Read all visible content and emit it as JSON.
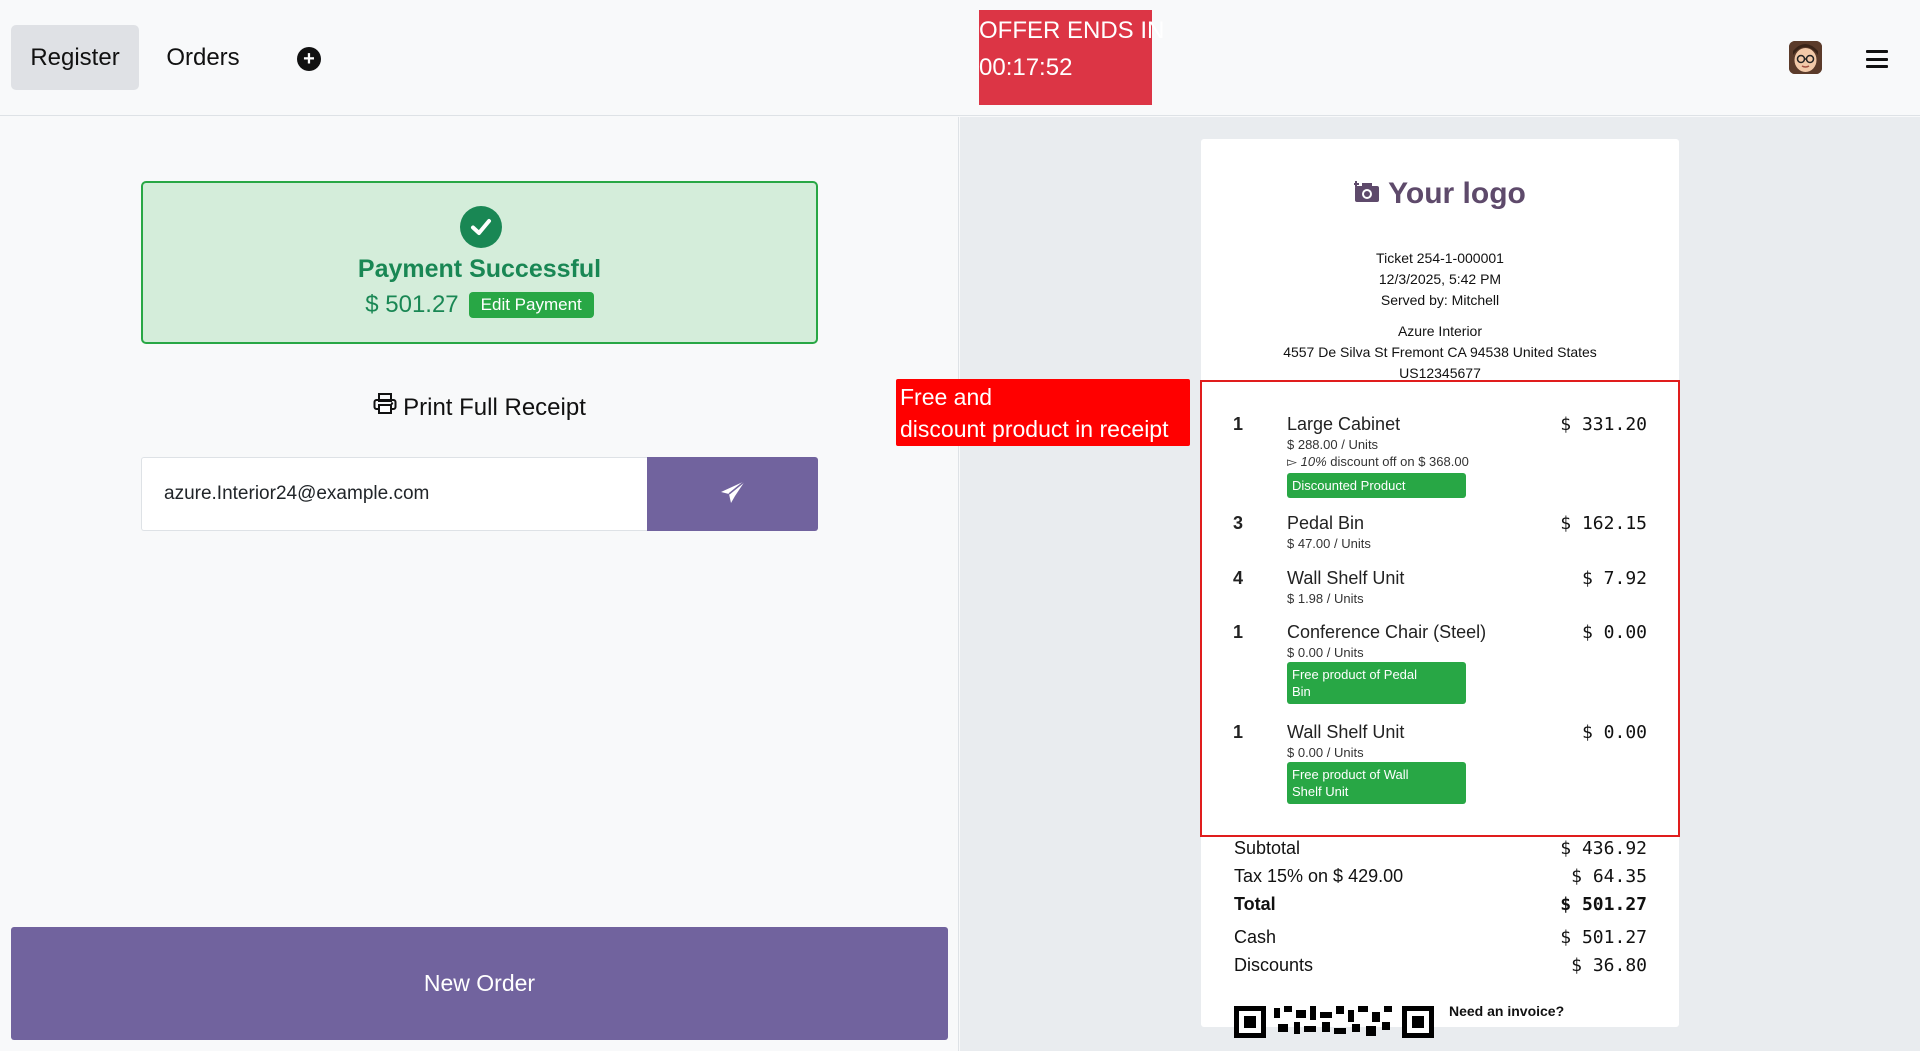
{
  "header": {
    "tabs": [
      {
        "label": "Register"
      },
      {
        "label": "Orders"
      }
    ],
    "offer": {
      "line1": "OFFER ENDS IN",
      "line2": "00:17:52"
    }
  },
  "payment": {
    "title": "Payment Successful",
    "amount": "$ 501.27",
    "edit_label": "Edit Payment",
    "print_label": "Print Full Receipt",
    "email_value": "azure.Interior24@example.com"
  },
  "new_order_label": "New Order",
  "annotation": {
    "line1": "Free and",
    "line2": "discount product in receipt"
  },
  "receipt": {
    "logo_text": "Your logo",
    "ticket": "Ticket 254-1-000001",
    "datetime": "12/3/2025, 5:42 PM",
    "served_by": "Served by: Mitchell",
    "company": "Azure Interior",
    "address": "4557 De Silva St Fremont CA 94538 United States",
    "vat": "US12345677",
    "items": [
      {
        "qty": "1",
        "name": "Large Cabinet",
        "unit": "$ 288.00 / Units",
        "price": "$ 331.20",
        "discount_pct": "10%",
        "discount_rest": " discount off on $ 368.00",
        "tag": "Discounted Product"
      },
      {
        "qty": "3",
        "name": "Pedal Bin",
        "unit": "$ 47.00 / Units",
        "price": "$ 162.15"
      },
      {
        "qty": "4",
        "name": "Wall Shelf Unit",
        "unit": "$ 1.98 / Units",
        "price": "$ 7.92"
      },
      {
        "qty": "1",
        "name": "Conference Chair (Steel)",
        "unit": "$ 0.00 / Units",
        "price": "$ 0.00",
        "tag_line1": "Free product of Pedal",
        "tag_line2": "Bin"
      },
      {
        "qty": "1",
        "name": "Wall Shelf Unit",
        "unit": "$ 0.00 / Units",
        "price": "$ 0.00",
        "tag_line1": "Free product of Wall",
        "tag_line2": "Shelf Unit"
      }
    ],
    "subtotal_label": "Subtotal",
    "subtotal": "$ 436.92",
    "tax_label": "Tax 15% on $ 429.00",
    "tax": "$ 64.35",
    "total_label": "Total",
    "total": "$ 501.27",
    "cash_label": "Cash",
    "cash": "$ 501.27",
    "discounts_label": "Discounts",
    "discounts": "$ 36.80",
    "invoice_label": "Need an invoice?"
  },
  "colors": {
    "accent": "#71639e",
    "success": "#28a745",
    "offer": "#dc3545",
    "annotation": "#ff0000"
  }
}
